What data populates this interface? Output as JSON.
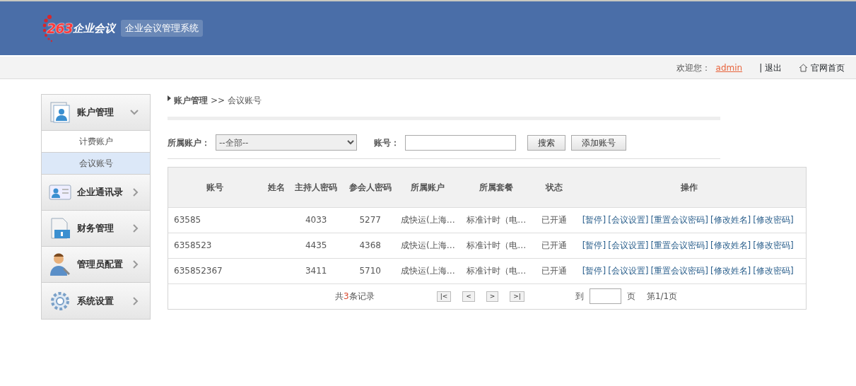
{
  "header": {
    "logo_number": "263",
    "logo_text": "企业会议",
    "system_title": "企业会议管理系统"
  },
  "topbar": {
    "welcome": "欢迎您：",
    "user": "admin",
    "logout": "| 退出",
    "home": "官网首页"
  },
  "sidebar": [
    {
      "label": "账户管理",
      "kind": "account",
      "expanded": true,
      "children": [
        {
          "label": "计费账户",
          "selected": false
        },
        {
          "label": "会议账号",
          "selected": true
        }
      ]
    },
    {
      "label": "企业通讯录",
      "kind": "contacts",
      "expanded": false
    },
    {
      "label": "财务管理",
      "kind": "finance",
      "expanded": false
    },
    {
      "label": "管理员配置",
      "kind": "admin",
      "expanded": false
    },
    {
      "label": "系统设置",
      "kind": "settings",
      "expanded": false
    }
  ],
  "breadcrumb": {
    "parent": "账户管理",
    "separator": ">>",
    "current": "会议账号"
  },
  "filter": {
    "account_label": "所属账户：",
    "account_value": "--全部--",
    "number_label": "账号：",
    "search_button": "搜索",
    "add_button": "添加账号"
  },
  "table": {
    "columns": [
      "账号",
      "姓名",
      "主持人密码",
      "参会人密码",
      "所属账户",
      "所属套餐",
      "状态",
      "操作"
    ],
    "rows": [
      {
        "cells": [
          "63585",
          "",
          "4033",
          "5277",
          "成快运(上海…",
          "标准计时（电…",
          "已开通"
        ],
        "actions": [
          "[暂停]",
          "[会议设置]",
          "[重置会议密码]",
          "[修改姓名]",
          "[修改密码]"
        ]
      },
      {
        "cells": [
          "6358523",
          "",
          "4435",
          "4368",
          "成快运(上海…",
          "标准计时（电…",
          "已开通"
        ],
        "actions": [
          "[暂停]",
          "[会议设置]",
          "[重置会议密码]",
          "[修改姓名]",
          "[修改密码]"
        ]
      },
      {
        "cells": [
          "635852367",
          "",
          "3411",
          "5710",
          "成快运(上海…",
          "标准计时（电…",
          "已开通"
        ],
        "actions": [
          "[暂停]",
          "[会议设置]",
          "[重置会议密码]",
          "[修改姓名]",
          "[修改密码]"
        ]
      }
    ]
  },
  "pager": {
    "total_prefix": "共",
    "total_count": "3",
    "total_suffix": "条记录",
    "buttons": [
      "|<",
      "<",
      ">",
      ">|"
    ],
    "goto_label": "到",
    "page_unit": "页",
    "page_info": "第1/1页"
  }
}
